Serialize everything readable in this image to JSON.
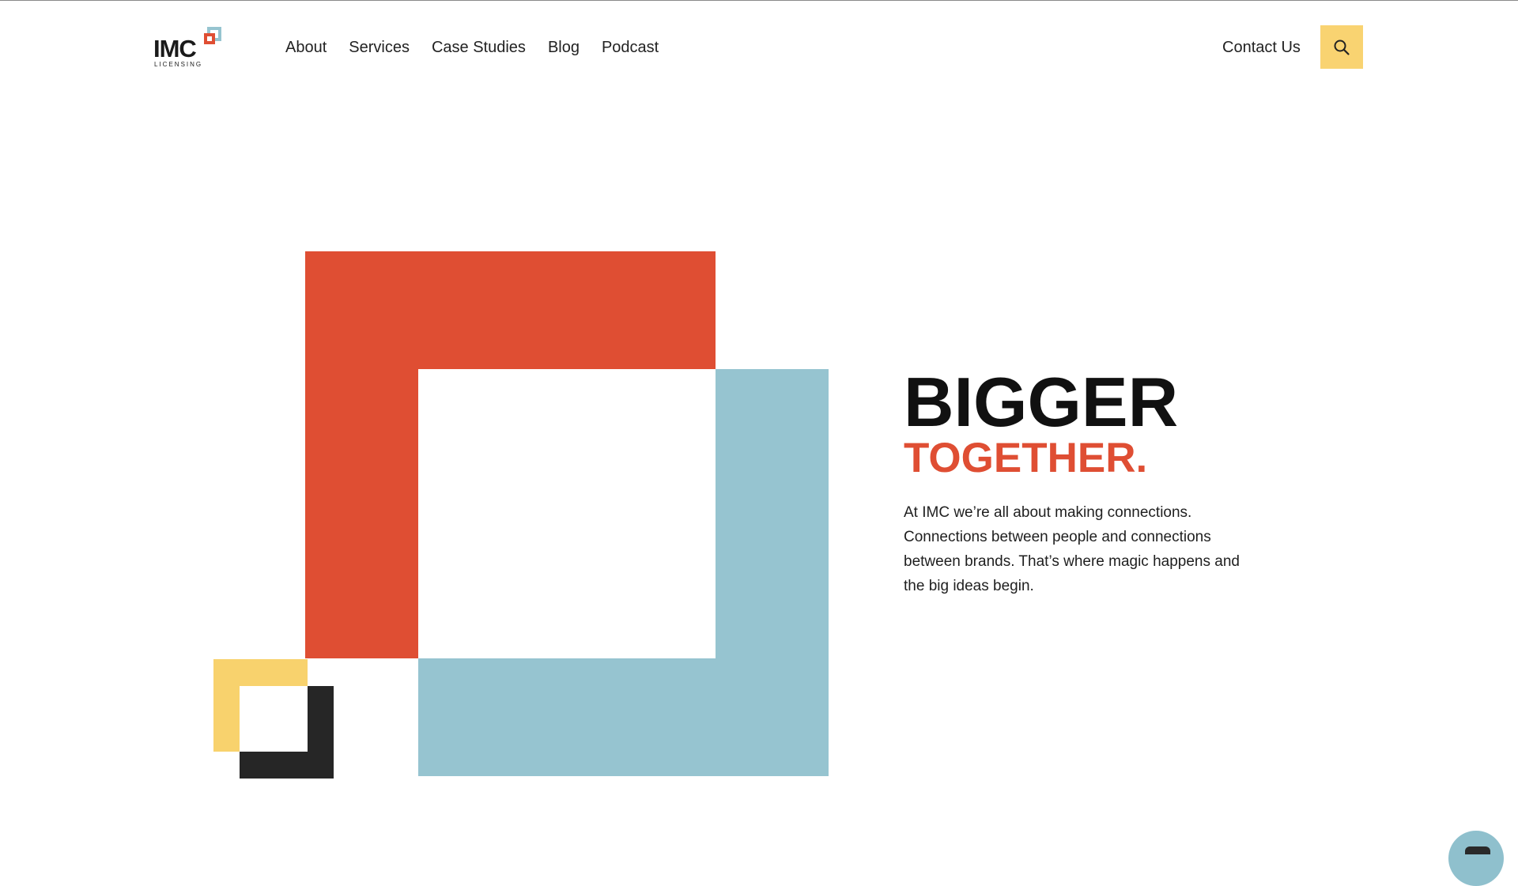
{
  "brand": {
    "name": "IMC",
    "tagline": "LICENSING",
    "colors": {
      "red": "#df4e33",
      "blue": "#96c4d0",
      "yellow": "#f8d26d",
      "dark": "#262626"
    }
  },
  "nav": {
    "items": [
      {
        "label": "About"
      },
      {
        "label": "Services"
      },
      {
        "label": "Case Studies"
      },
      {
        "label": "Blog"
      },
      {
        "label": "Podcast"
      }
    ],
    "contact_label": "Contact Us",
    "search_icon": "search-icon"
  },
  "hero": {
    "title": "BIGGER",
    "subtitle": "TOGETHER.",
    "body": "At IMC we’re all about making connections. Connections between people and connections between brands. That’s where magic happens and the big ideas begin."
  },
  "chat": {
    "icon": "chat-icon"
  }
}
